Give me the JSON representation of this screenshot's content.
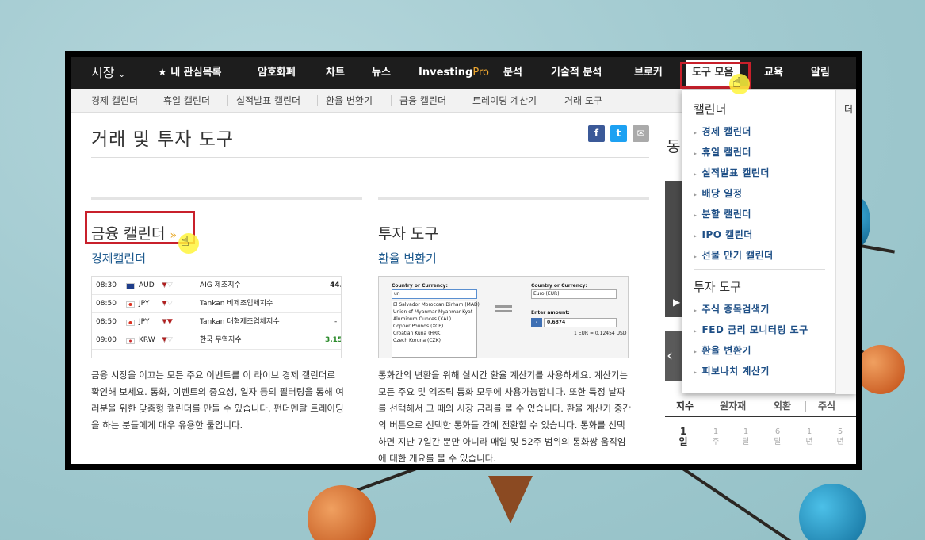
{
  "nav": {
    "market": "시장",
    "watchlist": "내 관심목록",
    "crypto": "암호화폐",
    "charts": "차트",
    "news": "뉴스",
    "investing_pro_a": "Investing",
    "investing_pro_b": "Pro",
    "analysis": "분석",
    "technical": "기술적 분석",
    "brokers": "브로커",
    "tools": "도구 모음",
    "education": "교육",
    "alerts": "알림"
  },
  "subnav": [
    "경제 캘린더",
    "휴일 캘린더",
    "실적발표 캘린더",
    "환율 변환기",
    "금융 캘린더",
    "트레이딩 계산기",
    "거래 도구"
  ],
  "page": {
    "title": "거래 및 투자 도구",
    "social_facebook": "f",
    "social_twitter": "t",
    "social_email": "✉"
  },
  "left_section": {
    "heading": "금융 캘린더",
    "raquo": "»",
    "link": "경제캘린더",
    "description": "금융 시장을 이끄는 모든 주요 이벤트를 이 라이브 경제 캘린더로 확인해 보세요. 통화, 이벤트의 중요성, 일자 등의 필터링을 통해 여러분을 위한 맞춤형 캘린더를 만들 수 있습니다. 펀더멘탈 트레이딩을 하는 분들에게 매우 유용한 툴입니다."
  },
  "calendar_preview": [
    {
      "time": "08:30",
      "currency": "AUD",
      "event": "AIG 제조지수",
      "value": "44."
    },
    {
      "time": "08:50",
      "currency": "JPY",
      "event": "Tankan 비제조업체지수",
      "value": ""
    },
    {
      "time": "08:50",
      "currency": "JPY",
      "event": "Tankan 대형제조업체지수",
      "value": "-"
    },
    {
      "time": "09:00",
      "currency": "KRW",
      "event": "한국 무역지수",
      "value": "3.15"
    }
  ],
  "right_section": {
    "heading": "투자 도구",
    "link": "환율 변환기",
    "description": "통화간의 변환을 위해 실시간 환율 계산기를 사용하세요. 계산기는 모든 주요 및 엑조틱 통화 모두에 사용가능합니다. 또한 특정 날짜를 선택해서 그 때의 시장 금리를 볼 수 있습니다. 환율 계산기 중간의 버튼으로 선택한 통화들 간에 전환할 수 있습니다. 통화를 선택하면 지난 7일간 뿐만 아니라 매일 및 52주 범위의 통화쌍 움직임에 대한 개요를 볼 수 있습니다."
  },
  "converter_preview": {
    "from_label": "Country or Currency:",
    "from_value": "un",
    "to_label": "Country or Currency:",
    "to_value": "Euro (EUR)",
    "amount_label": "Enter amount:",
    "amount_value": "0.6874",
    "rate": "1 EUR = 0.12454 USD",
    "list": [
      "El Salvador Moroccan Dirham (MAD)",
      "Union of Myanmar Myanmar Kyat",
      "Aluminum Ounces (XAL)",
      "Copper Pounds (XCP)",
      "Croatian Kuna (HRK)",
      "Czech Koruna (CZK)"
    ]
  },
  "sidebar": {
    "label": "동",
    "tabs": [
      "지수",
      "원자재",
      "외환",
      "주식"
    ],
    "periods": [
      [
        "1",
        "일"
      ],
      [
        "1",
        "주"
      ],
      [
        "1",
        "달"
      ],
      [
        "6",
        "달"
      ],
      [
        "1",
        "년"
      ],
      [
        "5",
        "년"
      ]
    ]
  },
  "dropdown": {
    "calendar_heading": "캘린더",
    "calendar_items": [
      "경제 캘린더",
      "휴일 캘린더",
      "실적발표 캘린더",
      "배당 일정",
      "분할 캘린더",
      "IPO 캘린더",
      "선물 만기 캘린더"
    ],
    "tools_heading": "투자 도구",
    "tools_items": [
      "주식 종목검색기",
      "FED 금리 모니터링 도구",
      "환율 변환기",
      "피보나치 계산기"
    ],
    "col2_heading": "더"
  },
  "colors": {
    "nav_bg": "#1d1d1d",
    "highlight_red": "#c8202b",
    "link_blue": "#1e5a8e",
    "pro_orange": "#f0a830"
  }
}
